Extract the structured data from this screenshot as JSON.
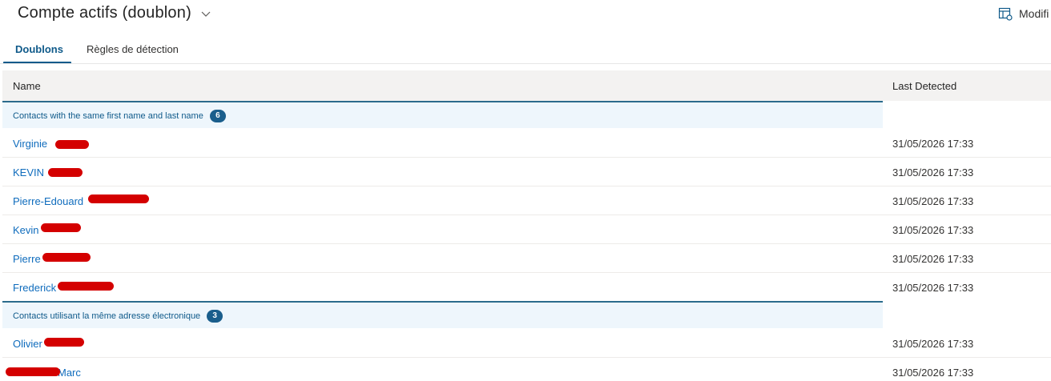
{
  "header": {
    "title": "Compte actifs (doublon)",
    "modify_label": "Modifi"
  },
  "tabs": [
    {
      "label": "Doublons",
      "active": true
    },
    {
      "label": "Règles de détection",
      "active": false
    }
  ],
  "grid": {
    "columns": {
      "name": "Name",
      "last_detected": "Last Detected"
    },
    "groups": [
      {
        "label": "Contacts with the same first name and last name",
        "count": "6",
        "rows": [
          {
            "name": "Virginie",
            "date": "31/05/2026 17:33"
          },
          {
            "name": "KEVIN",
            "date": "31/05/2026 17:33"
          },
          {
            "name": "Pierre-Edouard",
            "date": "31/05/2026 17:33"
          },
          {
            "name": "Kevin",
            "date": "31/05/2026 17:33"
          },
          {
            "name": "Pierre",
            "date": "31/05/2026 17:33"
          },
          {
            "name": "Frederick",
            "date": "31/05/2026 17:33"
          }
        ]
      },
      {
        "label": "Contacts utilisant la même adresse électronique",
        "count": "3",
        "rows": [
          {
            "name": "Olivier",
            "date": "31/05/2026 17:33"
          },
          {
            "name": "Marc",
            "date": "31/05/2026 17:33"
          }
        ]
      }
    ]
  },
  "colors": {
    "accent": "#0f5a8a",
    "link": "#0f6cbd",
    "redaction": "#d40000"
  }
}
